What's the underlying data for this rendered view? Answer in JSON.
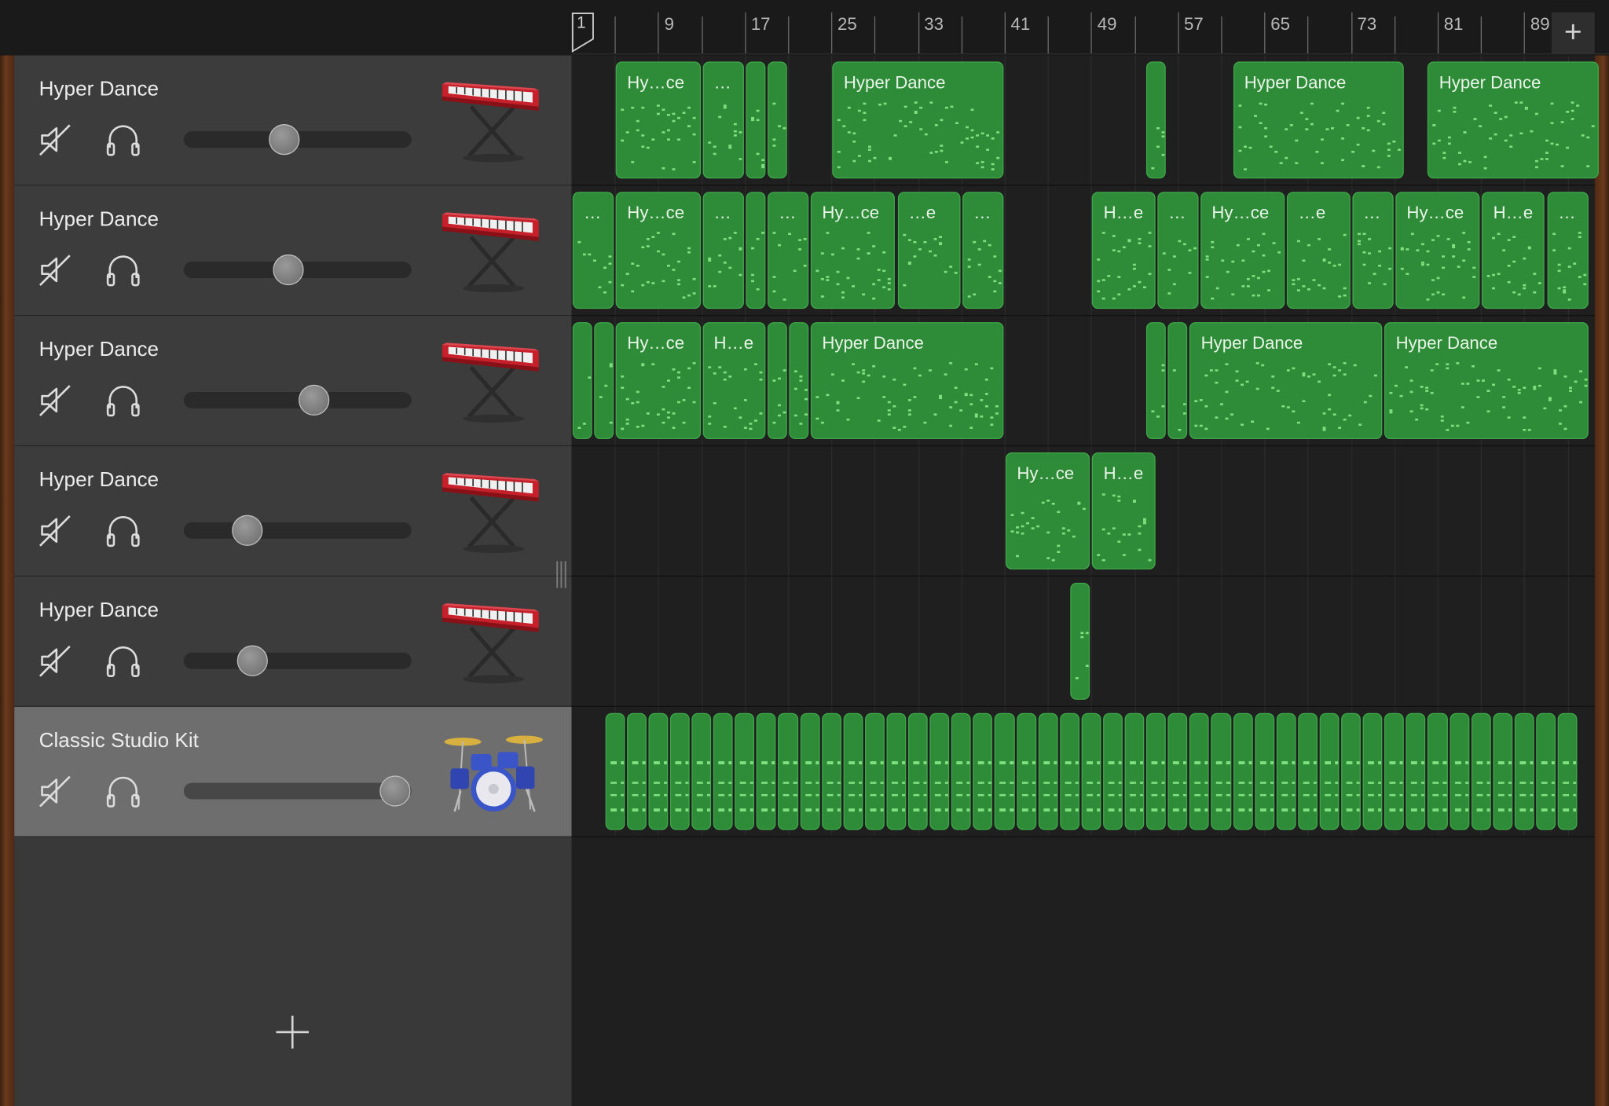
{
  "ruler": {
    "playhead_bar": "1",
    "bars": [
      "9",
      "17",
      "25",
      "33",
      "41",
      "49",
      "57",
      "65",
      "73",
      "81",
      "89"
    ],
    "add_button_symbol": "+"
  },
  "tracks": [
    {
      "name": "Hyper Dance",
      "instrument": "keyboard-icon",
      "volume": 0.44,
      "selected": false
    },
    {
      "name": "Hyper Dance",
      "instrument": "keyboard-icon",
      "volume": 0.46,
      "selected": false
    },
    {
      "name": "Hyper Dance",
      "instrument": "keyboard-icon",
      "volume": 0.57,
      "selected": false
    },
    {
      "name": "Hyper Dance",
      "instrument": "keyboard-icon",
      "volume": 0.28,
      "selected": false
    },
    {
      "name": "Hyper Dance",
      "instrument": "keyboard-icon",
      "volume": 0.3,
      "selected": false
    },
    {
      "name": "Classic Studio Kit",
      "instrument": "drum-kit-icon",
      "volume": 0.93,
      "selected": true
    }
  ],
  "regions": {
    "track1": [
      "Hy…ce",
      "…",
      "",
      "",
      "Hyper Dance",
      "",
      "Hyper Dance",
      "Hyper Dance"
    ],
    "track2": [
      "…",
      "Hy…ce",
      "…",
      "",
      "…",
      "Hy…ce",
      "…e",
      "…",
      "H…e",
      "…",
      "Hy…ce",
      "…e",
      "…",
      "Hy…ce",
      "H…e",
      "…"
    ],
    "track3": [
      "",
      "",
      "Hy…ce",
      "H…e",
      "",
      "",
      "Hyper Dance",
      "",
      "",
      "Hyper Dance",
      "Hyper Dance"
    ],
    "track4": [
      "Hy…ce",
      "H…e"
    ],
    "track5": [
      ""
    ],
    "track6": []
  },
  "colors": {
    "region": "#2e8b37",
    "region_border": "#3fa84a",
    "note": "#7fe07f",
    "selected_header": "#6e6e6e"
  }
}
